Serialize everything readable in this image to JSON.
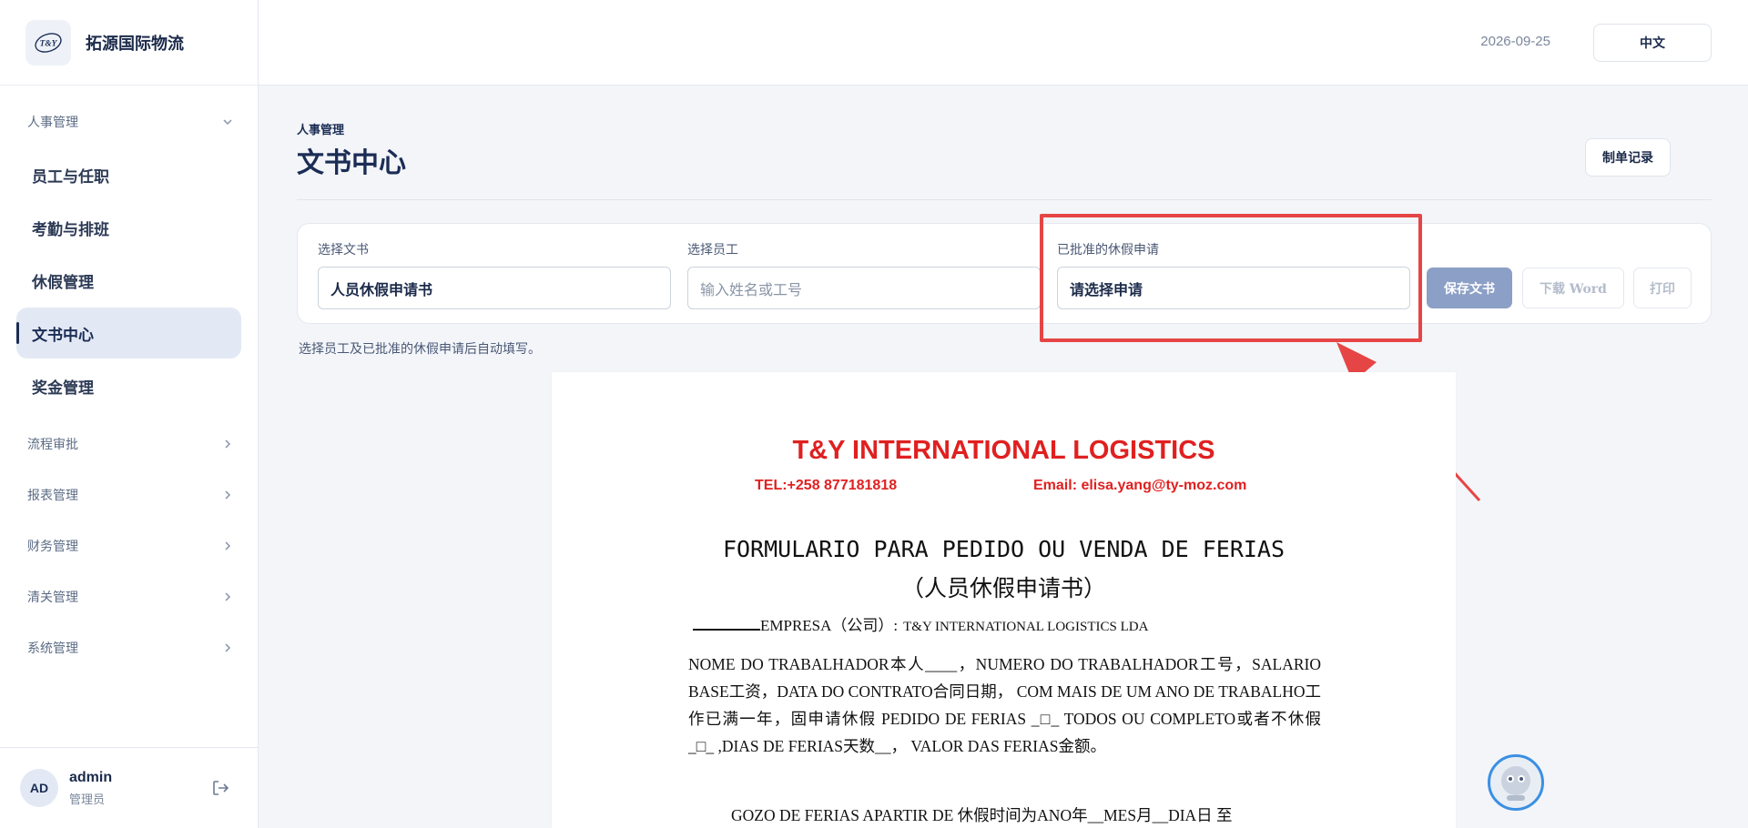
{
  "brand": {
    "name": "拓源国际物流",
    "logo_text": "T&Y"
  },
  "sidebar": {
    "groups": [
      {
        "label": "人事管理",
        "expanded": true,
        "items": [
          {
            "label": "员工与任职"
          },
          {
            "label": "考勤与排班"
          },
          {
            "label": "休假管理"
          },
          {
            "label": "文书中心",
            "active": true
          },
          {
            "label": "奖金管理"
          }
        ]
      },
      {
        "label": "流程审批",
        "expanded": false
      },
      {
        "label": "报表管理",
        "expanded": false
      },
      {
        "label": "财务管理",
        "expanded": false
      },
      {
        "label": "清关管理",
        "expanded": false
      },
      {
        "label": "系统管理",
        "expanded": false
      }
    ]
  },
  "user": {
    "initials": "AD",
    "name": "admin",
    "role": "管理员"
  },
  "topbar": {
    "date": "2026-09-25",
    "language": "中文"
  },
  "page": {
    "breadcrumb": "人事管理",
    "title": "文书中心",
    "records_button": "制单记录"
  },
  "form": {
    "document": {
      "label": "选择文书",
      "value": "人员休假申请书"
    },
    "employee": {
      "label": "选择员工",
      "placeholder": "输入姓名或工号"
    },
    "leave": {
      "label": "已批准的休假申请",
      "value": "请选择申请"
    },
    "save_label": "保存文书",
    "download_label": "下载 Word",
    "print_label": "打印",
    "hint": "选择员工及已批准的休假申请后自动填写。"
  },
  "document_preview": {
    "company": "T&Y INTERNATIONAL LOGISTICS",
    "tel": "TEL:+258 877181818",
    "email": "Email: elisa.yang@ty-moz.com",
    "title_pt": "FORMULARIO PARA PEDIDO OU VENDA DE FERIAS",
    "title_cn": "（人员休假申请书）",
    "empresa_label": "EMPRESA（公司）:",
    "empresa_value": "T&Y INTERNATIONAL LOGISTICS LDA",
    "paragraph1": "NOME DO TRABALHADOR本人____，NUMERO DO TRABALHADOR工号，SALARIO BASE工资，DATA DO CONTRATO合同日期， COM MAIS DE UM ANO DE TRABALHO工作已满一年，固申请休假 PEDIDO DE FERIAS _□_ TODOS OU COMPLETO或者不休假 _□_ ,DIAS DE FERIAS天数__， VALOR DAS FERIAS金额。",
    "paragraph2": "GOZO DE FERIAS APARTIR DE 休假时间为ANO年__MES月__DIA日 至"
  },
  "colors": {
    "accent": "#1b2d55",
    "highlight": "#e64545",
    "doc_red": "#e02020"
  }
}
